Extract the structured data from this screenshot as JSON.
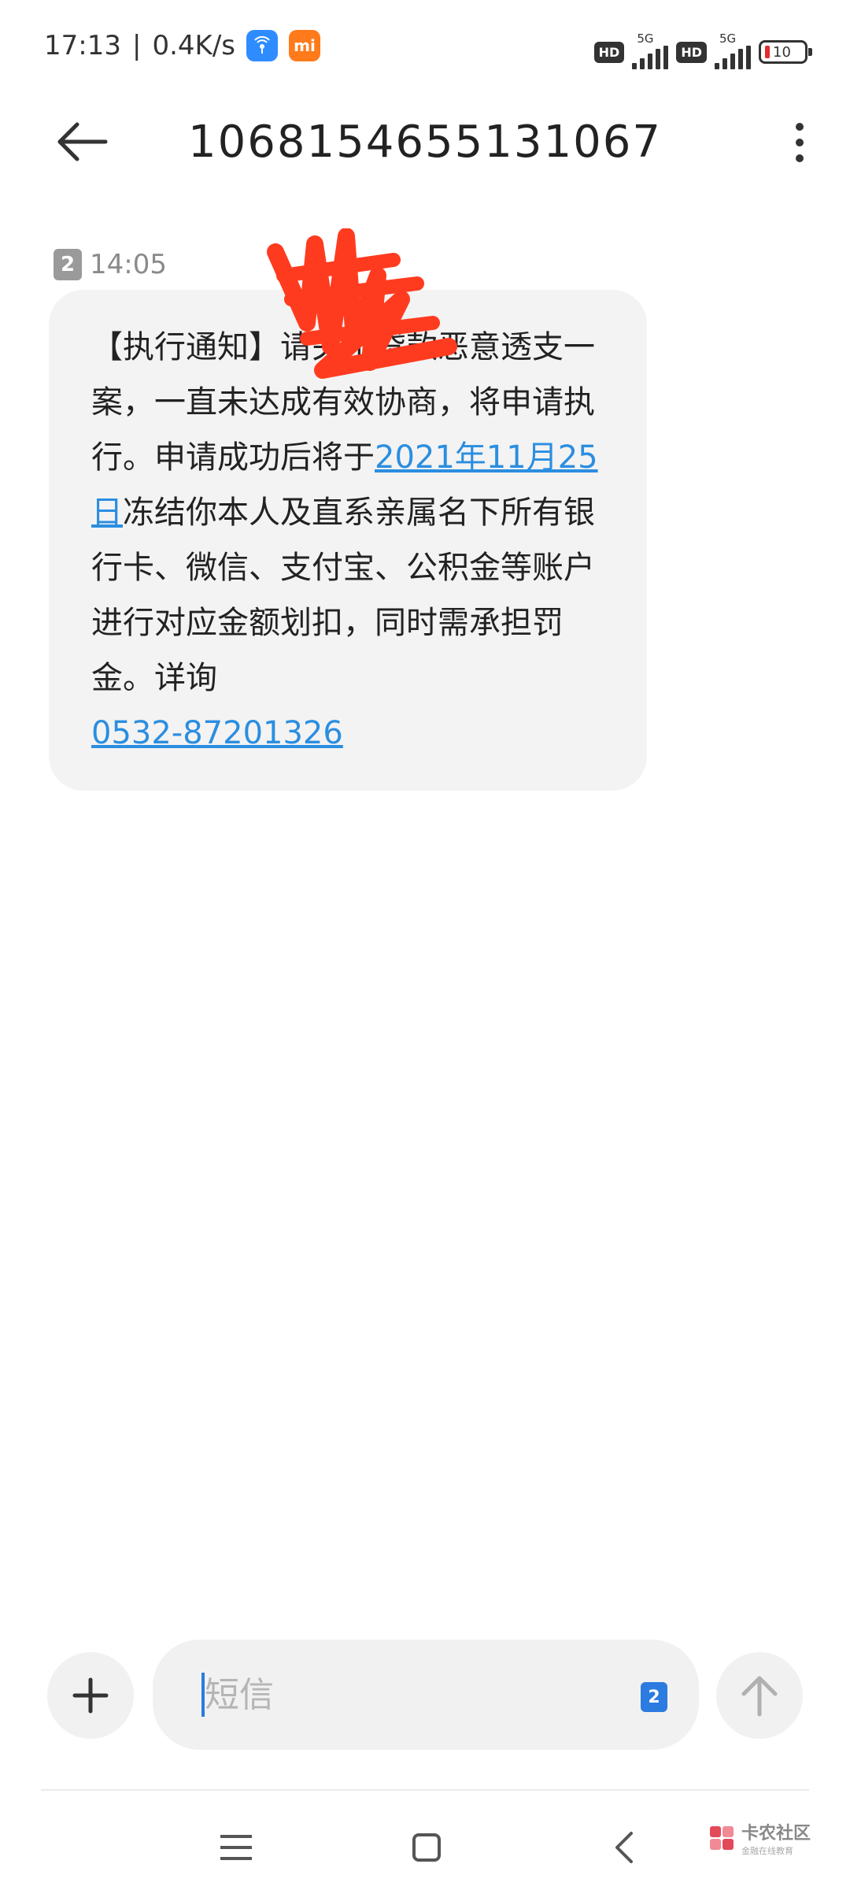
{
  "status_bar": {
    "time": "17:13",
    "separator": "|",
    "net_speed": "0.4K/s",
    "hd_label": "HD",
    "network_type": "5G",
    "battery_level": "10",
    "icons": [
      "wifi-hotspot-icon",
      "mi-icon",
      "signal-icon",
      "battery-icon"
    ]
  },
  "header": {
    "title": "1068154655131067"
  },
  "message": {
    "sim_slot": "2",
    "time": "14:05",
    "text_part1": "【执行通知】请",
    "text_part2": "关于贷款恶意透支一案，一直未达成有效协商，将申请执行。申请成功后将于",
    "link_date": "2021年11月25日",
    "text_part3": "冻结你本人及直系亲属名下所有银行卡、微信、支付宝、公积金等账户进行对应金额划扣，同时需承担罚金。详询",
    "link_phone": "0532-87201326"
  },
  "composer": {
    "placeholder": "短信",
    "sim_slot": "2"
  },
  "watermark": {
    "main": "卡农社区",
    "sub": "金融在线教育"
  },
  "colors": {
    "link": "#2b8ee0",
    "bubble": "#f3f3f3",
    "scribble": "#ff3b1f",
    "sim_blue": "#2b7be0"
  }
}
